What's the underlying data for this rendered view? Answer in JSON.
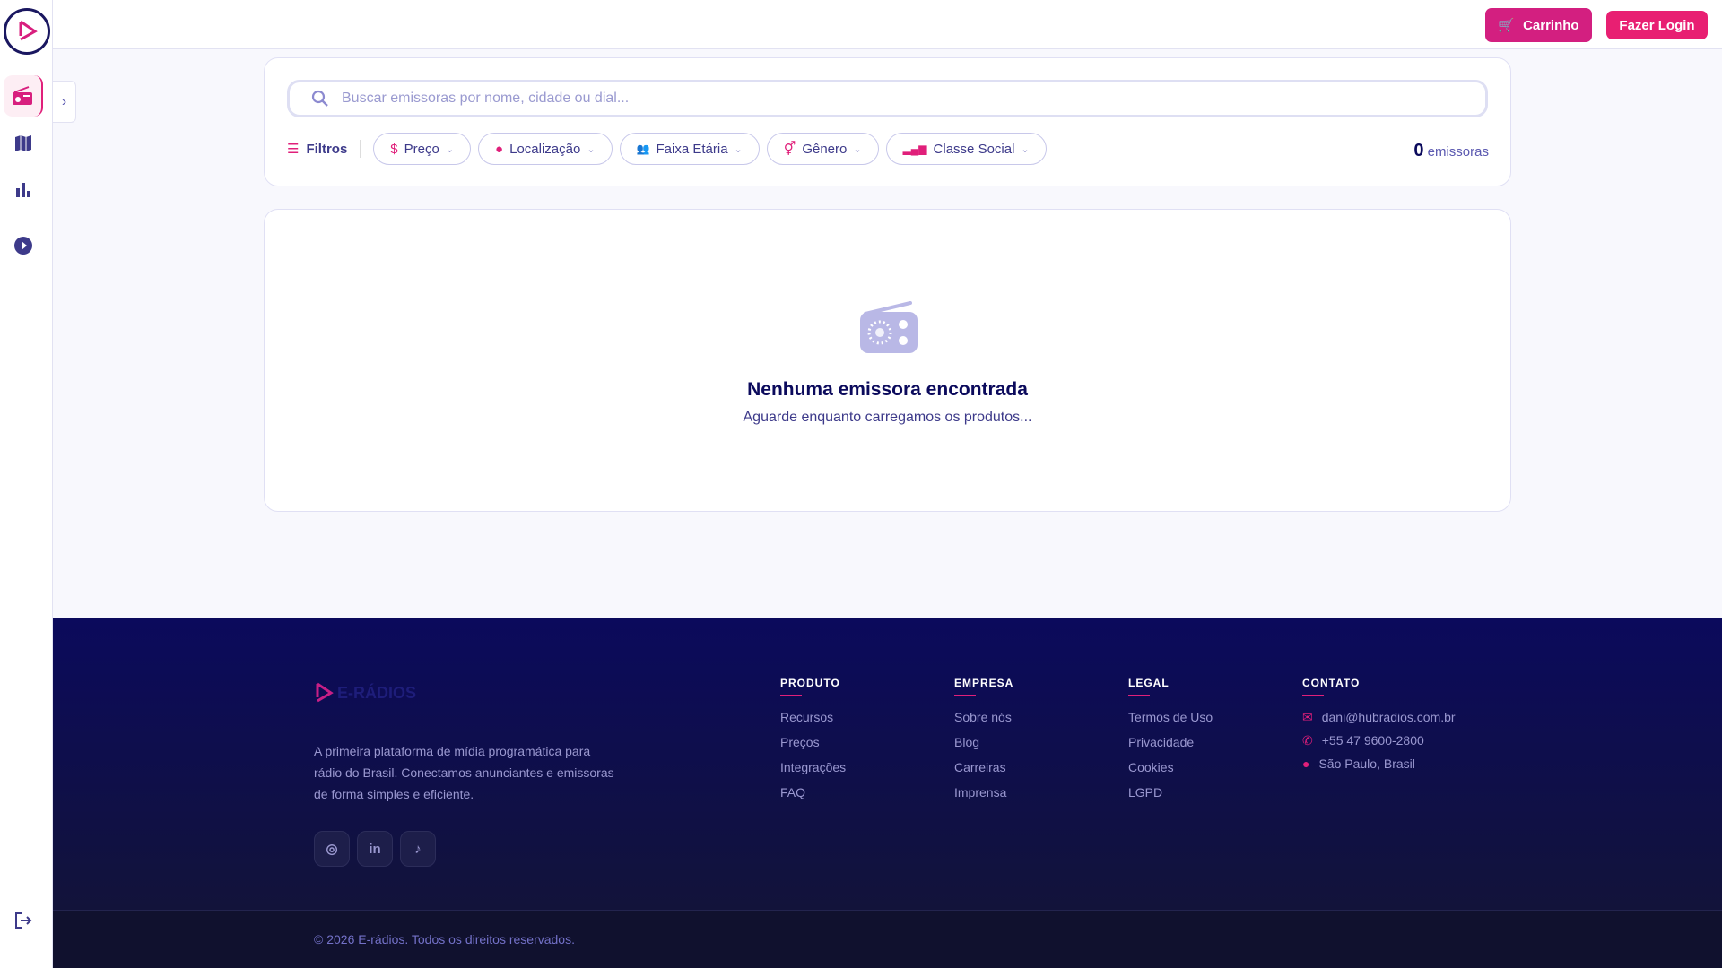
{
  "header": {
    "cart_label": "Carrinho",
    "login_label": "Fazer Login"
  },
  "sidebar": {
    "items": [
      "radio-icon",
      "map-icon",
      "chart-icon",
      "play-icon"
    ],
    "logout": "logout-icon"
  },
  "search": {
    "placeholder": "Buscar emissoras por nome, cidade ou dial..."
  },
  "filters": {
    "label": "Filtros",
    "chips": [
      "Preço",
      "Localização",
      "Faixa Etária",
      "Gênero",
      "Classe Social"
    ],
    "count": "0",
    "count_label": "emissoras"
  },
  "empty": {
    "title": "Nenhuma emissora encontrada",
    "subtitle": "Aguarde enquanto carregamos os produtos..."
  },
  "footer": {
    "logo_text": "E-RÁDIOS",
    "description": "A primeira plataforma de mídia programática para rádio do Brasil. Conectamos anunciantes e emissoras de forma simples e eficiente.",
    "columns": [
      {
        "title": "PRODUTO",
        "links": [
          "Recursos",
          "Preços",
          "Integrações",
          "FAQ"
        ]
      },
      {
        "title": "EMPRESA",
        "links": [
          "Sobre nós",
          "Blog",
          "Carreiras",
          "Imprensa"
        ]
      },
      {
        "title": "LEGAL",
        "links": [
          "Termos de Uso",
          "Privacidade",
          "Cookies",
          "LGPD"
        ]
      }
    ],
    "contact": {
      "title": "CONTATO",
      "email": "dani@hubradios.com.br",
      "phone": "+55 47 9600-2800",
      "location": "São Paulo, Brasil"
    },
    "copyright": "© 2026 E-rádios. Todos os direitos reservados."
  },
  "colors": {
    "accent": "#e01f7a",
    "navy": "#0b0a5c"
  }
}
